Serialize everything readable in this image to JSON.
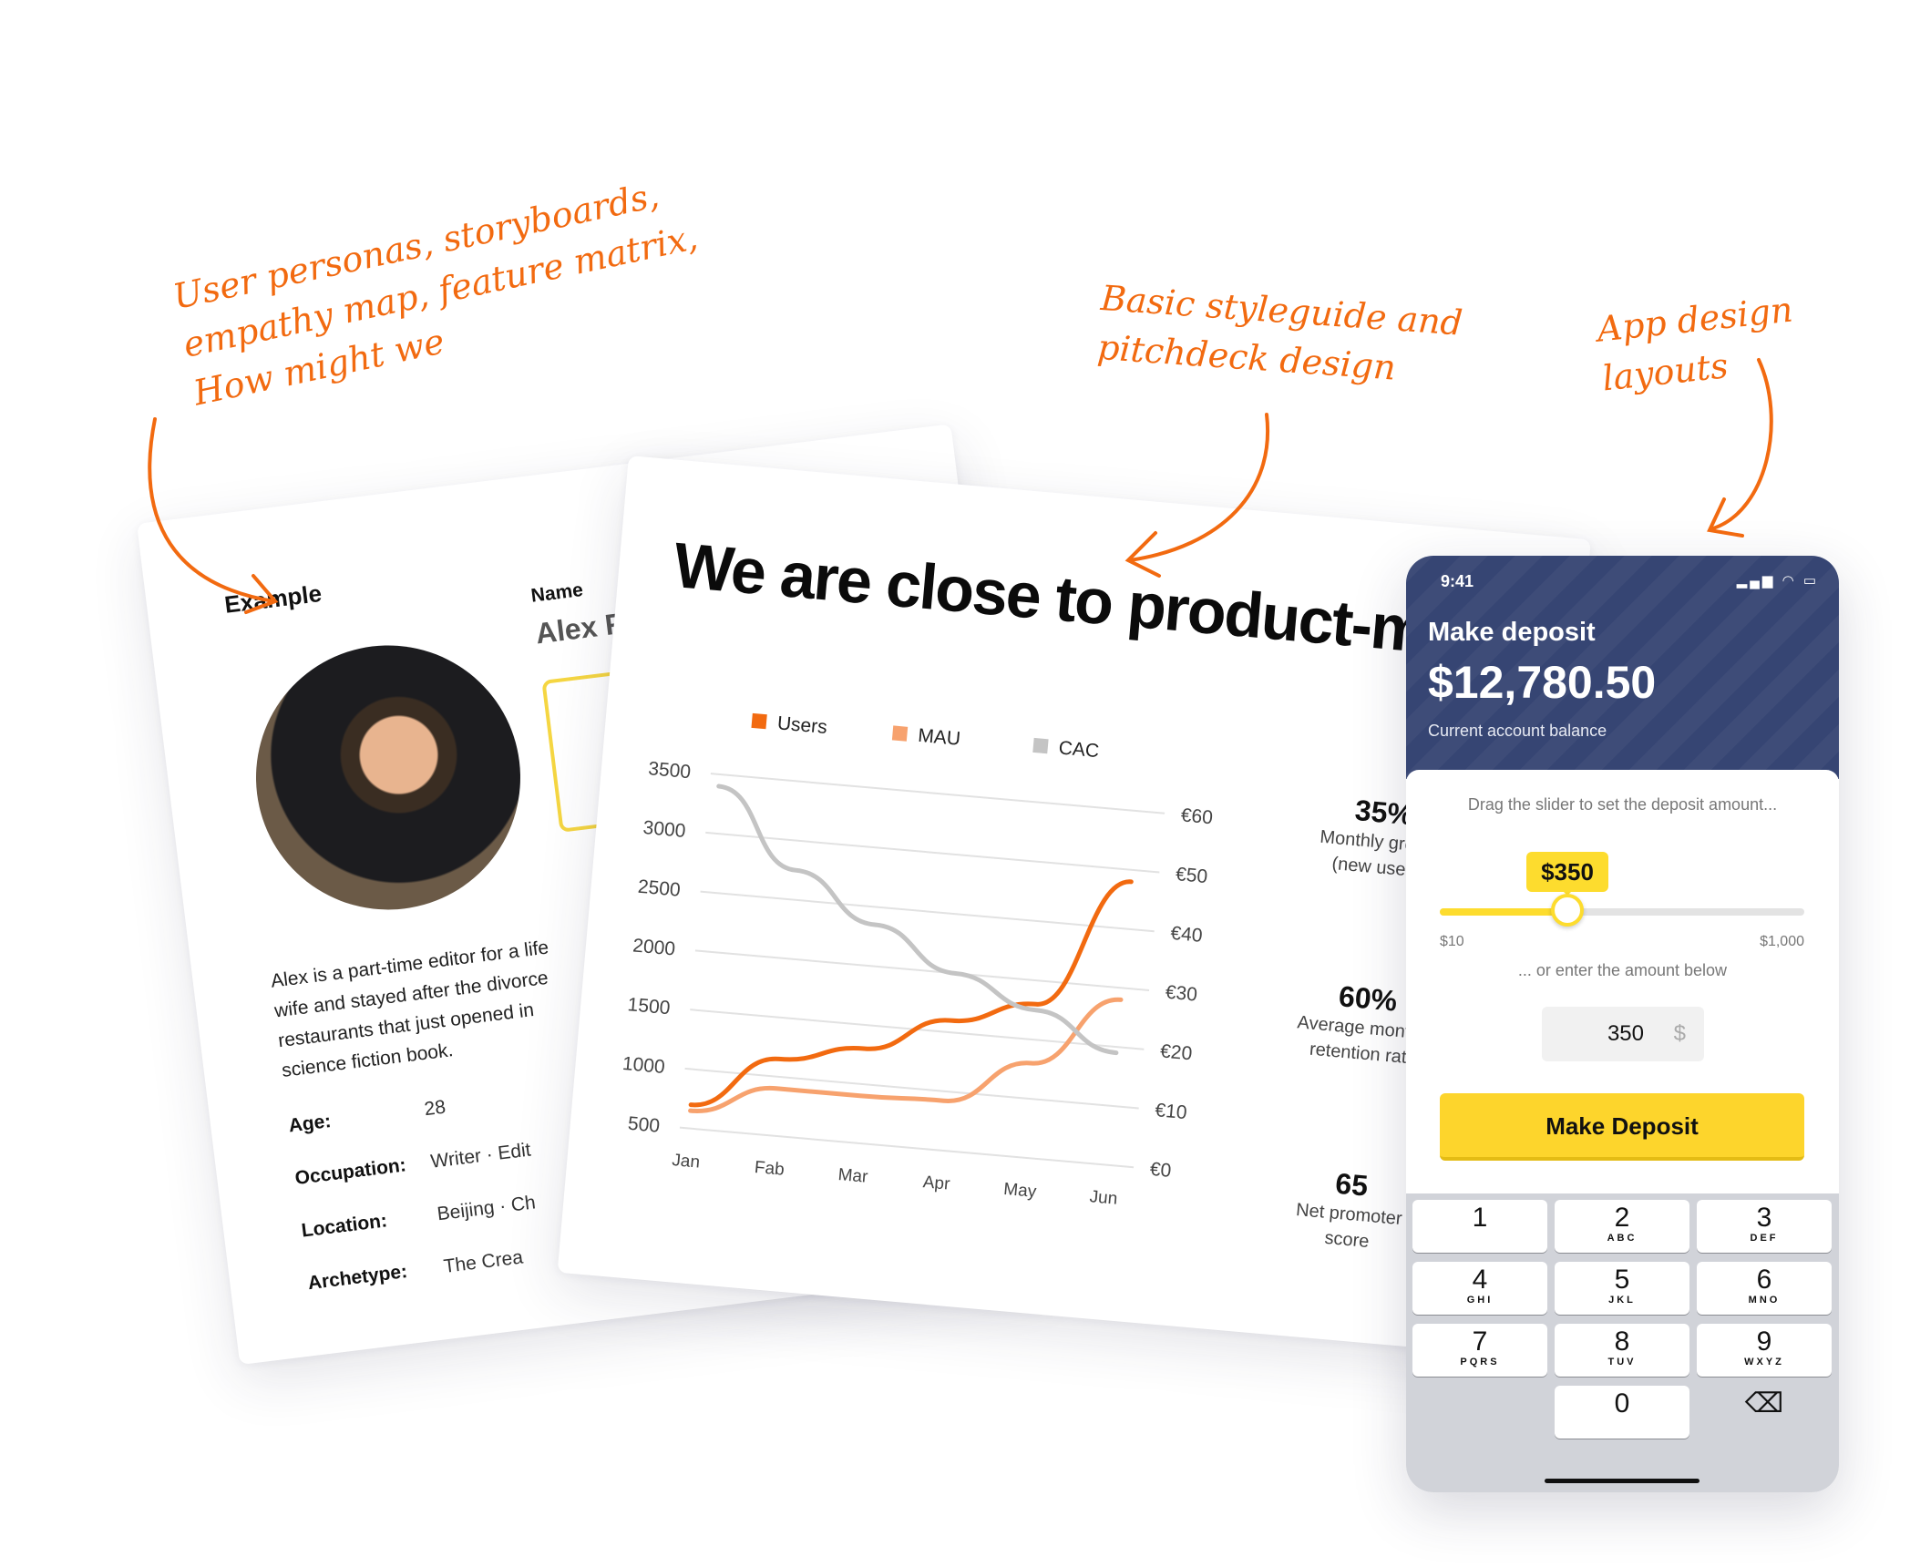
{
  "annotations": {
    "personas": [
      "User personas, storyboards,",
      "empathy map, feature matrix,",
      "How might we"
    ],
    "styleguide": [
      "Basic styleguide and",
      "pitchdeck design"
    ],
    "app": [
      "App design",
      "layouts"
    ]
  },
  "persona": {
    "example_label": "Example",
    "name_label": "Name",
    "name_value": "Alex F",
    "bio_lines": [
      "Alex is a part-time editor for a life",
      "wife and stayed after the divorce",
      "restaurants that just opened in",
      "science fiction book."
    ],
    "fields": [
      {
        "key": "Age:",
        "value": "28"
      },
      {
        "key": "Occupation:",
        "value": "Writer · Edit"
      },
      {
        "key": "Location:",
        "value": "Beijing · Ch"
      },
      {
        "key": "Archetype:",
        "value": "The Crea"
      }
    ]
  },
  "pitch": {
    "headline": "We are close to product-mar",
    "kpis": [
      {
        "value": "35%",
        "label_lines": [
          "Monthly growth",
          "(new users)"
        ]
      },
      {
        "value": "60%",
        "label_lines": [
          "Average monthly",
          "retention rate"
        ]
      },
      {
        "value": "65",
        "label_lines": [
          "Net promoter",
          "score"
        ]
      }
    ]
  },
  "chart_data": {
    "type": "line",
    "categories": [
      "Jan",
      "Fab",
      "Mar",
      "Apr",
      "May",
      "Jun"
    ],
    "y_left_ticks": [
      "3500",
      "3000",
      "2500",
      "2000",
      "1500",
      "1000",
      "500"
    ],
    "y_right_ticks": [
      "€60",
      "€50",
      "€40",
      "€30",
      "€20",
      "€10",
      "€0"
    ],
    "ylim_left": [
      500,
      3500
    ],
    "ylim_right": [
      0,
      60
    ],
    "grid": true,
    "legend_position": "top",
    "series": [
      {
        "name": "Users",
        "color": "#f26a10",
        "axis": "left",
        "values": [
          700,
          1150,
          1300,
          1600,
          1800,
          2900
        ]
      },
      {
        "name": "MAU",
        "color": "#f7a26e",
        "axis": "left",
        "values": [
          650,
          900,
          900,
          920,
          1300,
          1900
        ]
      },
      {
        "name": "CAC",
        "color": "#c4c4c4",
        "axis": "right",
        "values": [
          58,
          45,
          37,
          30,
          25,
          19
        ]
      }
    ]
  },
  "phone": {
    "status_time": "9:41",
    "status_icons": "▂▄▆ ◠ ▭",
    "title": "Make deposit",
    "balance": "$12,780.50",
    "balance_label": "Current account balance",
    "slider_hint": "Drag the slider to set the deposit amount...",
    "slider_value_label": "$350",
    "slider_fraction": 0.35,
    "slider_min": "$10",
    "slider_max": "$1,000",
    "enter_hint": "... or enter the amount below",
    "amount_value": "350",
    "amount_currency": "$",
    "button_label": "Make Deposit",
    "keys": [
      {
        "d": "1",
        "l": ""
      },
      {
        "d": "2",
        "l": "ABC"
      },
      {
        "d": "3",
        "l": "DEF"
      },
      {
        "d": "4",
        "l": "GHI"
      },
      {
        "d": "5",
        "l": "JKL"
      },
      {
        "d": "6",
        "l": "MNO"
      },
      {
        "d": "7",
        "l": "PQRS"
      },
      {
        "d": "8",
        "l": "TUV"
      },
      {
        "d": "9",
        "l": "WXYZ"
      },
      {
        "d": "",
        "l": ""
      },
      {
        "d": "0",
        "l": ""
      },
      {
        "d": "⌫",
        "l": ""
      }
    ]
  }
}
